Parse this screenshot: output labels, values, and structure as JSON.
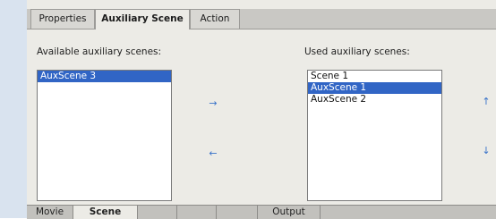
{
  "top_tabs": [
    "Properties",
    "Auxiliary Scene",
    "Action"
  ],
  "available": {
    "label": "Available auxiliary scenes:",
    "items": [
      "AuxScene 3"
    ],
    "selected_index": 0
  },
  "used": {
    "label": "Used auxiliary scenes:",
    "items": [
      "Scene 1",
      "AuxScene 1",
      "AuxScene 2"
    ],
    "selected_index": 1
  },
  "arrows": {
    "add": "→",
    "remove": "←",
    "move_up": "↑",
    "move_down": "↓"
  },
  "bottom_tabs": [
    "Movie",
    "Scene",
    "",
    "",
    "",
    "Output",
    ""
  ],
  "colors": {
    "selection": "#3165c5",
    "arrow": "#3a73c9",
    "panel": "#ecebe6"
  }
}
